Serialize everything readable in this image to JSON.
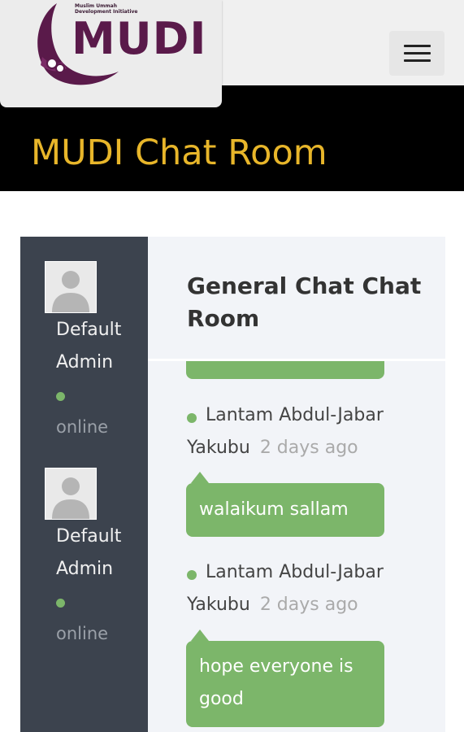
{
  "logo": {
    "tagline": "Muslim Ummah\nDevelopment Initiative",
    "text": "MUDI",
    "brand_color": "#5a1a4a"
  },
  "menu": {
    "icon": "hamburger-icon"
  },
  "page": {
    "title": "MUDI Chat Room",
    "title_color": "#e8b62a"
  },
  "sidebar": {
    "users": [
      {
        "name": "Default Admin",
        "status": "online",
        "avatar": "default-avatar-icon"
      },
      {
        "name": "Default Admin",
        "status": "online",
        "avatar": "default-avatar-icon"
      }
    ]
  },
  "room": {
    "title": "General Chat Chat Room"
  },
  "messages": [
    {
      "author": "Lantam Abdul-Jabar Yakubu",
      "author_line1": "Lantam Abdul-Jabar",
      "author_line2": "Yakubu",
      "time": "2 days ago",
      "text": "walaikum sallam"
    },
    {
      "author": "Lantam Abdul-Jabar Yakubu",
      "author_line1": "Lantam Abdul-Jabar",
      "author_line2": "Yakubu",
      "time": "2 days ago",
      "text_line1": "hope everyone is",
      "text_line2": "good"
    }
  ],
  "colors": {
    "bubble": "#7cb66a",
    "sidebar": "#3c434e",
    "band": "#000000"
  }
}
